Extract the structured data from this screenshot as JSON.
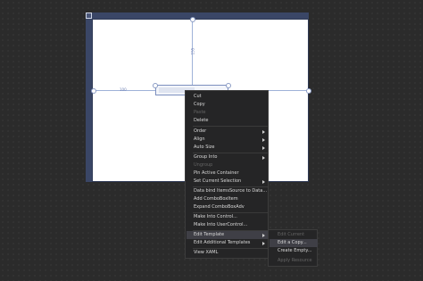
{
  "designer": {
    "guide_top_value": "155",
    "guide_left_value": "100"
  },
  "context_menu": {
    "items": [
      {
        "label": "Cut",
        "disabled": false
      },
      {
        "label": "Copy",
        "disabled": false
      },
      {
        "label": "Paste",
        "disabled": true
      },
      {
        "label": "Delete",
        "disabled": false
      },
      {
        "label": "Order",
        "disabled": false,
        "submenu": true
      },
      {
        "label": "Align",
        "disabled": false,
        "submenu": true
      },
      {
        "label": "Auto Size",
        "disabled": false,
        "submenu": true
      },
      {
        "label": "Group Into",
        "disabled": false,
        "submenu": true
      },
      {
        "label": "Ungroup",
        "disabled": true
      },
      {
        "label": "Pin Active Container",
        "disabled": false
      },
      {
        "label": "Set Current Selection",
        "disabled": false,
        "submenu": true
      },
      {
        "label": "Data bind ItemsSource to Data...",
        "disabled": false
      },
      {
        "label": "Add ComboBoxItem",
        "disabled": false
      },
      {
        "label": "Expand ComboBoxAdv",
        "disabled": false
      },
      {
        "label": "Make Into Control...",
        "disabled": false
      },
      {
        "label": "Make Into UserControl...",
        "disabled": false
      },
      {
        "label": "Edit Template",
        "disabled": false,
        "submenu": true,
        "highlight": true
      },
      {
        "label": "Edit Additional Templates",
        "disabled": false,
        "submenu": true
      },
      {
        "label": "View XAML",
        "disabled": false
      }
    ]
  },
  "edit_template_submenu": {
    "items": [
      {
        "label": "Edit Current",
        "disabled": true
      },
      {
        "label": "Edit a Copy...",
        "disabled": false,
        "highlight": true
      },
      {
        "label": "Create Empty...",
        "disabled": false
      },
      {
        "label": "Apply Resource",
        "disabled": true
      }
    ]
  }
}
